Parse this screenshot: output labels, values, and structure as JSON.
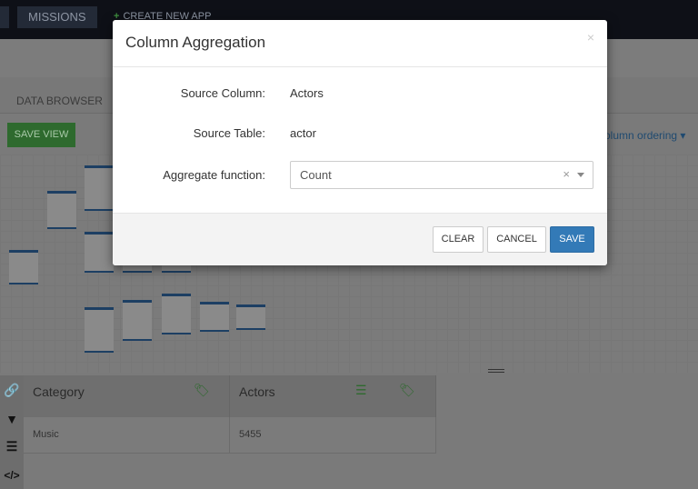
{
  "nav": {
    "missions": "MISSIONS",
    "create_app": "CREATE NEW APP"
  },
  "tabs": {
    "data_browser": "DATA BROWSER"
  },
  "toolbar": {
    "save_view": "SAVE VIEW",
    "column_ordering": "olumn ordering ▾"
  },
  "grid": {
    "columns": [
      {
        "label": "Category"
      },
      {
        "label": "Actors"
      }
    ],
    "rows": [
      [
        "Music",
        "5455"
      ]
    ]
  },
  "modal": {
    "title": "Column Aggregation",
    "close": "×",
    "source_column_label": "Source Column:",
    "source_column_value": "Actors",
    "source_table_label": "Source Table:",
    "source_table_value": "actor",
    "aggregate_label": "Aggregate function:",
    "aggregate_value": "Count",
    "clear_x": "×",
    "buttons": {
      "clear": "CLEAR",
      "cancel": "CANCEL",
      "save": "SAVE"
    }
  },
  "colors": {
    "primary": "#337ab7",
    "success": "#3f8f3f",
    "nav": "#0e1017"
  }
}
